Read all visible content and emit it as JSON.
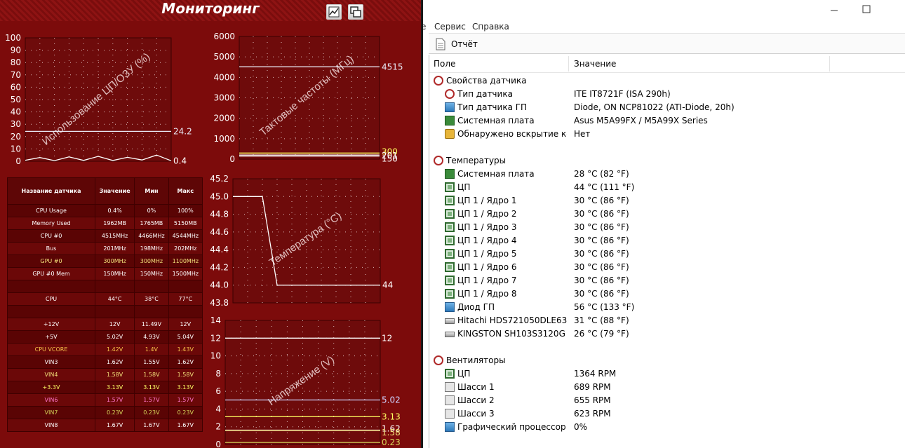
{
  "monitor": {
    "title": "Мониторинг",
    "buttons": [
      "graph-icon",
      "window-icon"
    ],
    "graphs": [
      {
        "id": "cpu-ram",
        "watermark": "Использование ЦП/ОЗУ (%)",
        "y_ticks": [
          "100",
          "90",
          "80",
          "70",
          "60",
          "50",
          "40",
          "30",
          "20",
          "10",
          "0"
        ],
        "labels": [
          {
            "text": "24.2"
          },
          {
            "text": "0.4"
          }
        ],
        "chart_data": {
          "type": "line",
          "ylim": [
            0,
            100
          ],
          "series": [
            {
              "values": [
                24.2,
                24.2,
                24.2,
                24.2,
                24.2,
                24.2,
                24.2,
                24.2,
                24.2,
                24.2
              ]
            },
            {
              "values": [
                0.8,
                3,
                0.5,
                3.5,
                0.7,
                4,
                0.6,
                3.2,
                1,
                5,
                0.4
              ]
            }
          ]
        }
      },
      {
        "id": "clocks",
        "watermark": "Тактовые частоты (МГц)",
        "y_ticks": [
          "6000",
          "5000",
          "4000",
          "3000",
          "2000",
          "1000",
          "0"
        ],
        "labels": [
          {
            "text": "4515"
          },
          {
            "text": "300"
          },
          {
            "text": "201"
          },
          {
            "text": "150"
          }
        ],
        "chart_data": {
          "type": "line",
          "ylim": [
            0,
            6000
          ],
          "series": [
            {
              "name": "CPU #0",
              "values": [
                4515,
                4515
              ]
            },
            {
              "name": "GPU #0",
              "values": [
                300,
                300
              ]
            },
            {
              "name": "Bus",
              "values": [
                201,
                201
              ]
            },
            {
              "name": "GPU #0 Mem",
              "values": [
                150,
                150
              ]
            }
          ]
        }
      },
      {
        "id": "temps",
        "watermark": "Температура (°C)",
        "y_ticks": [
          "45.2",
          "45.0",
          "44.8",
          "44.6",
          "44.4",
          "44.2",
          "44.0",
          "43.8"
        ],
        "labels": [
          {
            "text": "44"
          }
        ],
        "chart_data": {
          "type": "line",
          "ylim": [
            43.8,
            45.2
          ],
          "series": [
            {
              "name": "CPU",
              "values": [
                45,
                45,
                45,
                44,
                44,
                44,
                44,
                44,
                44,
                44,
                44
              ]
            }
          ]
        }
      },
      {
        "id": "voltages",
        "watermark": "Напряжение (V)",
        "y_ticks": [
          "14",
          "12",
          "10",
          "8",
          "6",
          "4",
          "2",
          "0"
        ],
        "labels": [
          {
            "text": "12"
          },
          {
            "text": "5.02"
          },
          {
            "text": "3.13"
          },
          {
            "text": "1.62"
          },
          {
            "text": "1.58"
          },
          {
            "text": "0.23"
          }
        ],
        "chart_data": {
          "type": "line",
          "ylim": [
            0,
            14
          ],
          "series": [
            {
              "name": "+12V",
              "values": [
                12,
                12
              ]
            },
            {
              "name": "+5V",
              "values": [
                5.02,
                5.02
              ]
            },
            {
              "name": "+3.3V",
              "values": [
                3.13,
                3.13
              ]
            },
            {
              "name": "VIN3",
              "values": [
                1.62,
                1.62
              ]
            },
            {
              "name": "VIN4",
              "values": [
                1.58,
                1.58
              ]
            },
            {
              "name": "VIN7",
              "values": [
                0.23,
                0.23
              ]
            }
          ]
        }
      }
    ],
    "table": {
      "headers": [
        "Название датчика",
        "Значение",
        "Мин",
        "Макс"
      ],
      "rows": [
        {
          "cells": [
            "CPU Usage",
            "0.4%",
            "0%",
            "100%"
          ],
          "color": "#ffffff"
        },
        {
          "cells": [
            "Memory Used",
            "1962MB",
            "1765MB",
            "5150MB"
          ],
          "color": "#ffffff"
        },
        {
          "cells": [
            "CPU #0",
            "4515MHz",
            "4466MHz",
            "4544MHz"
          ],
          "color": "#ffffff"
        },
        {
          "cells": [
            "Bus",
            "201MHz",
            "198MHz",
            "202MHz"
          ],
          "color": "#ffffff"
        },
        {
          "cells": [
            "GPU #0",
            "300MHz",
            "300MHz",
            "1100MHz"
          ],
          "color": "#f2e07a"
        },
        {
          "cells": [
            "GPU #0 Mem",
            "150MHz",
            "150MHz",
            "1500MHz"
          ],
          "color": "#ffffff"
        },
        {
          "cells": [
            "",
            "",
            "",
            ""
          ],
          "color": "#ffffff"
        },
        {
          "cells": [
            "CPU",
            "44°C",
            "38°C",
            "77°C"
          ],
          "color": "#ffffff"
        },
        {
          "cells": [
            "",
            "",
            "",
            ""
          ],
          "color": "#ffffff"
        },
        {
          "cells": [
            "+12V",
            "12V",
            "11.49V",
            "12V"
          ],
          "color": "#ffffff"
        },
        {
          "cells": [
            "+5V",
            "5.02V",
            "4.93V",
            "5.04V"
          ],
          "color": "#ffffff"
        },
        {
          "cells": [
            "CPU VCORE",
            "1.42V",
            "1.4V",
            "1.43V"
          ],
          "color": "#f6c24a"
        },
        {
          "cells": [
            "VIN3",
            "1.62V",
            "1.55V",
            "1.62V"
          ],
          "color": "#ffffff"
        },
        {
          "cells": [
            "VIN4",
            "1.58V",
            "1.58V",
            "1.58V"
          ],
          "color": "#f2e07a"
        },
        {
          "cells": [
            "+3.3V",
            "3.13V",
            "3.13V",
            "3.13V"
          ],
          "color": "#ffff66"
        },
        {
          "cells": [
            "VIN6",
            "1.57V",
            "1.57V",
            "1.57V"
          ],
          "color": "#ff77cc"
        },
        {
          "cells": [
            "VIN7",
            "0.23V",
            "0.23V",
            "0.23V"
          ],
          "color": "#d6d65a"
        },
        {
          "cells": [
            "VIN8",
            "1.67V",
            "1.67V",
            "1.67V"
          ],
          "color": "#ffffff"
        }
      ]
    }
  },
  "window": {
    "menu": [
      "е",
      "Сервис",
      "Справка"
    ],
    "toolbar": {
      "report_label": "Отчёт"
    },
    "columns": {
      "field": "Поле",
      "value": "Значение"
    },
    "rows": [
      {
        "level": 0,
        "icon": "gauge-icon",
        "field": "Свойства датчика",
        "value": ""
      },
      {
        "level": 1,
        "icon": "gauge-icon",
        "field": "Тип датчика",
        "value": "ITE IT8721F  (ISA 290h)"
      },
      {
        "level": 1,
        "icon": "gpu-icon",
        "field": "Тип датчика ГП",
        "value": "Diode, ON NCP81022  (ATI-Diode, 20h)"
      },
      {
        "level": 1,
        "icon": "motherboard-icon",
        "field": "Системная плата",
        "value": "Asus M5A99FX / M5A99X Series"
      },
      {
        "level": 1,
        "icon": "lock-icon",
        "field": "Обнаружено вскрытие кор...",
        "value": "Нет"
      },
      {
        "level": -1,
        "icon": "",
        "field": "",
        "value": ""
      },
      {
        "level": 0,
        "icon": "thermometer-icon",
        "field": "Температуры",
        "value": ""
      },
      {
        "level": 1,
        "icon": "motherboard-icon",
        "field": "Системная плата",
        "value": "28 °C  (82 °F)"
      },
      {
        "level": 1,
        "icon": "cpu-icon",
        "field": "ЦП",
        "value": "44 °C  (111 °F)"
      },
      {
        "level": 1,
        "icon": "cpu-icon",
        "field": "ЦП 1 / Ядро 1",
        "value": "30 °C  (86 °F)"
      },
      {
        "level": 1,
        "icon": "cpu-icon",
        "field": "ЦП 1 / Ядро 2",
        "value": "30 °C  (86 °F)"
      },
      {
        "level": 1,
        "icon": "cpu-icon",
        "field": "ЦП 1 / Ядро 3",
        "value": "30 °C  (86 °F)"
      },
      {
        "level": 1,
        "icon": "cpu-icon",
        "field": "ЦП 1 / Ядро 4",
        "value": "30 °C  (86 °F)"
      },
      {
        "level": 1,
        "icon": "cpu-icon",
        "field": "ЦП 1 / Ядро 5",
        "value": "30 °C  (86 °F)"
      },
      {
        "level": 1,
        "icon": "cpu-icon",
        "field": "ЦП 1 / Ядро 6",
        "value": "30 °C  (86 °F)"
      },
      {
        "level": 1,
        "icon": "cpu-icon",
        "field": "ЦП 1 / Ядро 7",
        "value": "30 °C  (86 °F)"
      },
      {
        "level": 1,
        "icon": "cpu-icon",
        "field": "ЦП 1 / Ядро 8",
        "value": "30 °C  (86 °F)"
      },
      {
        "level": 1,
        "icon": "gpu-icon",
        "field": "Диод ГП",
        "value": "56 °C  (133 °F)"
      },
      {
        "level": 1,
        "icon": "disk-icon",
        "field": "Hitachi HDS721050DLE630",
        "value": "31 °C  (88 °F)"
      },
      {
        "level": 1,
        "icon": "disk-icon",
        "field": "KINGSTON SH103S3120G",
        "value": "26 °C  (79 °F)"
      },
      {
        "level": -1,
        "icon": "",
        "field": "",
        "value": ""
      },
      {
        "level": 0,
        "icon": "fan-icon",
        "field": "Вентиляторы",
        "value": ""
      },
      {
        "level": 1,
        "icon": "cpu-icon",
        "field": "ЦП",
        "value": "1364 RPM"
      },
      {
        "level": 1,
        "icon": "case-fan-icon",
        "field": "Шасси 1",
        "value": "689 RPM"
      },
      {
        "level": 1,
        "icon": "case-fan-icon",
        "field": "Шасси 2",
        "value": "655 RPM"
      },
      {
        "level": 1,
        "icon": "case-fan-icon",
        "field": "Шасси 3",
        "value": "623 RPM"
      },
      {
        "level": 1,
        "icon": "gpu-icon",
        "field": "Графический процессор",
        "value": "0%"
      }
    ]
  }
}
